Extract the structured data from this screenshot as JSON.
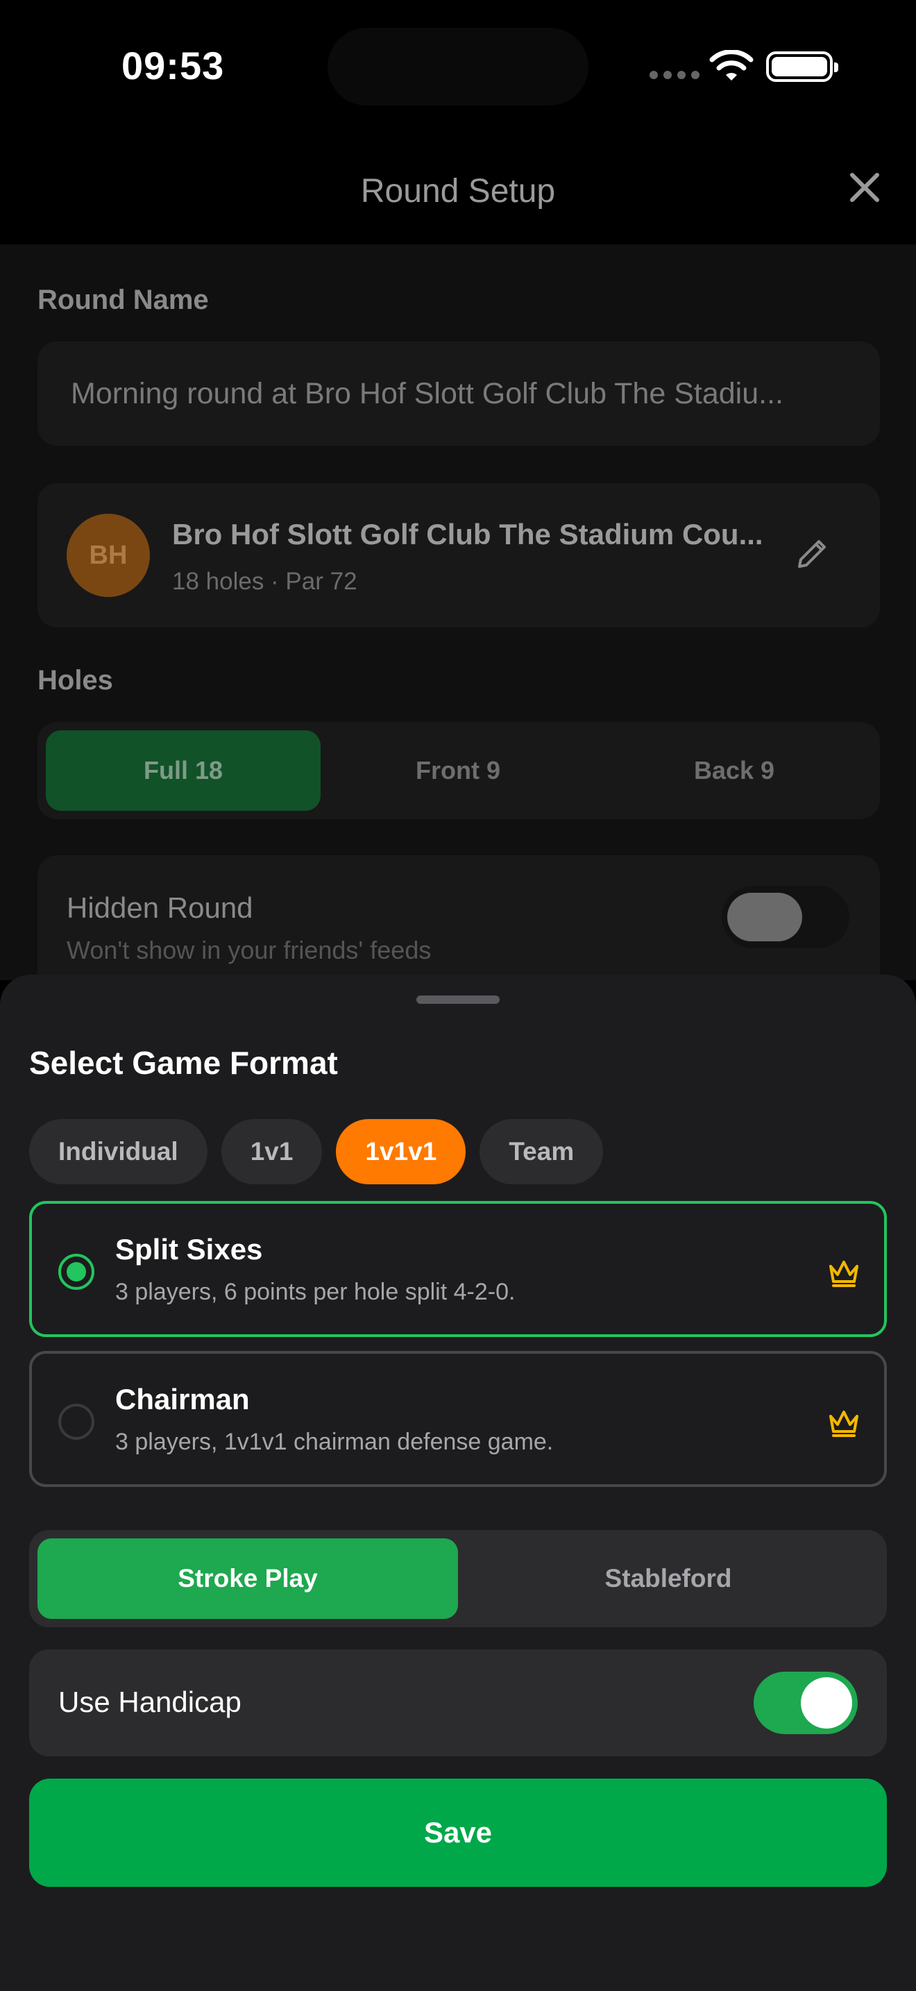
{
  "status_bar": {
    "time": "09:53"
  },
  "header": {
    "title": "Round Setup"
  },
  "round_name": {
    "label": "Round Name",
    "value": "Morning round at Bro Hof Slott Golf Club The Stadiu..."
  },
  "course": {
    "initials": "BH",
    "name": "Bro Hof Slott Golf Club The Stadium Cou...",
    "meta": "18 holes · Par 72"
  },
  "holes": {
    "label": "Holes",
    "options": [
      "Full 18",
      "Front 9",
      "Back 9"
    ],
    "selected": "Full 18"
  },
  "hidden_round": {
    "title": "Hidden Round",
    "subtitle": "Won't show in your friends' feeds",
    "enabled": false
  },
  "sheet": {
    "title": "Select Game Format",
    "categories": [
      "Individual",
      "1v1",
      "1v1v1",
      "Team"
    ],
    "selected_category": "1v1v1",
    "formats": [
      {
        "name": "Split Sixes",
        "description": "3 players, 6 points per hole split 4-2-0.",
        "selected": true,
        "premium_icon": "crown-icon"
      },
      {
        "name": "Chairman",
        "description": "3 players, 1v1v1 chairman defense game.",
        "selected": false,
        "premium_icon": "crown-icon"
      }
    ],
    "scoring": {
      "options": [
        "Stroke Play",
        "Stableford"
      ],
      "selected": "Stroke Play"
    },
    "handicap": {
      "label": "Use Handicap",
      "enabled": true
    },
    "save_label": "Save"
  },
  "colors": {
    "accent_green": "#22c55e",
    "button_green": "#00a84a",
    "chip_orange": "#ff7a00",
    "crown_gold": "#f5b800"
  }
}
